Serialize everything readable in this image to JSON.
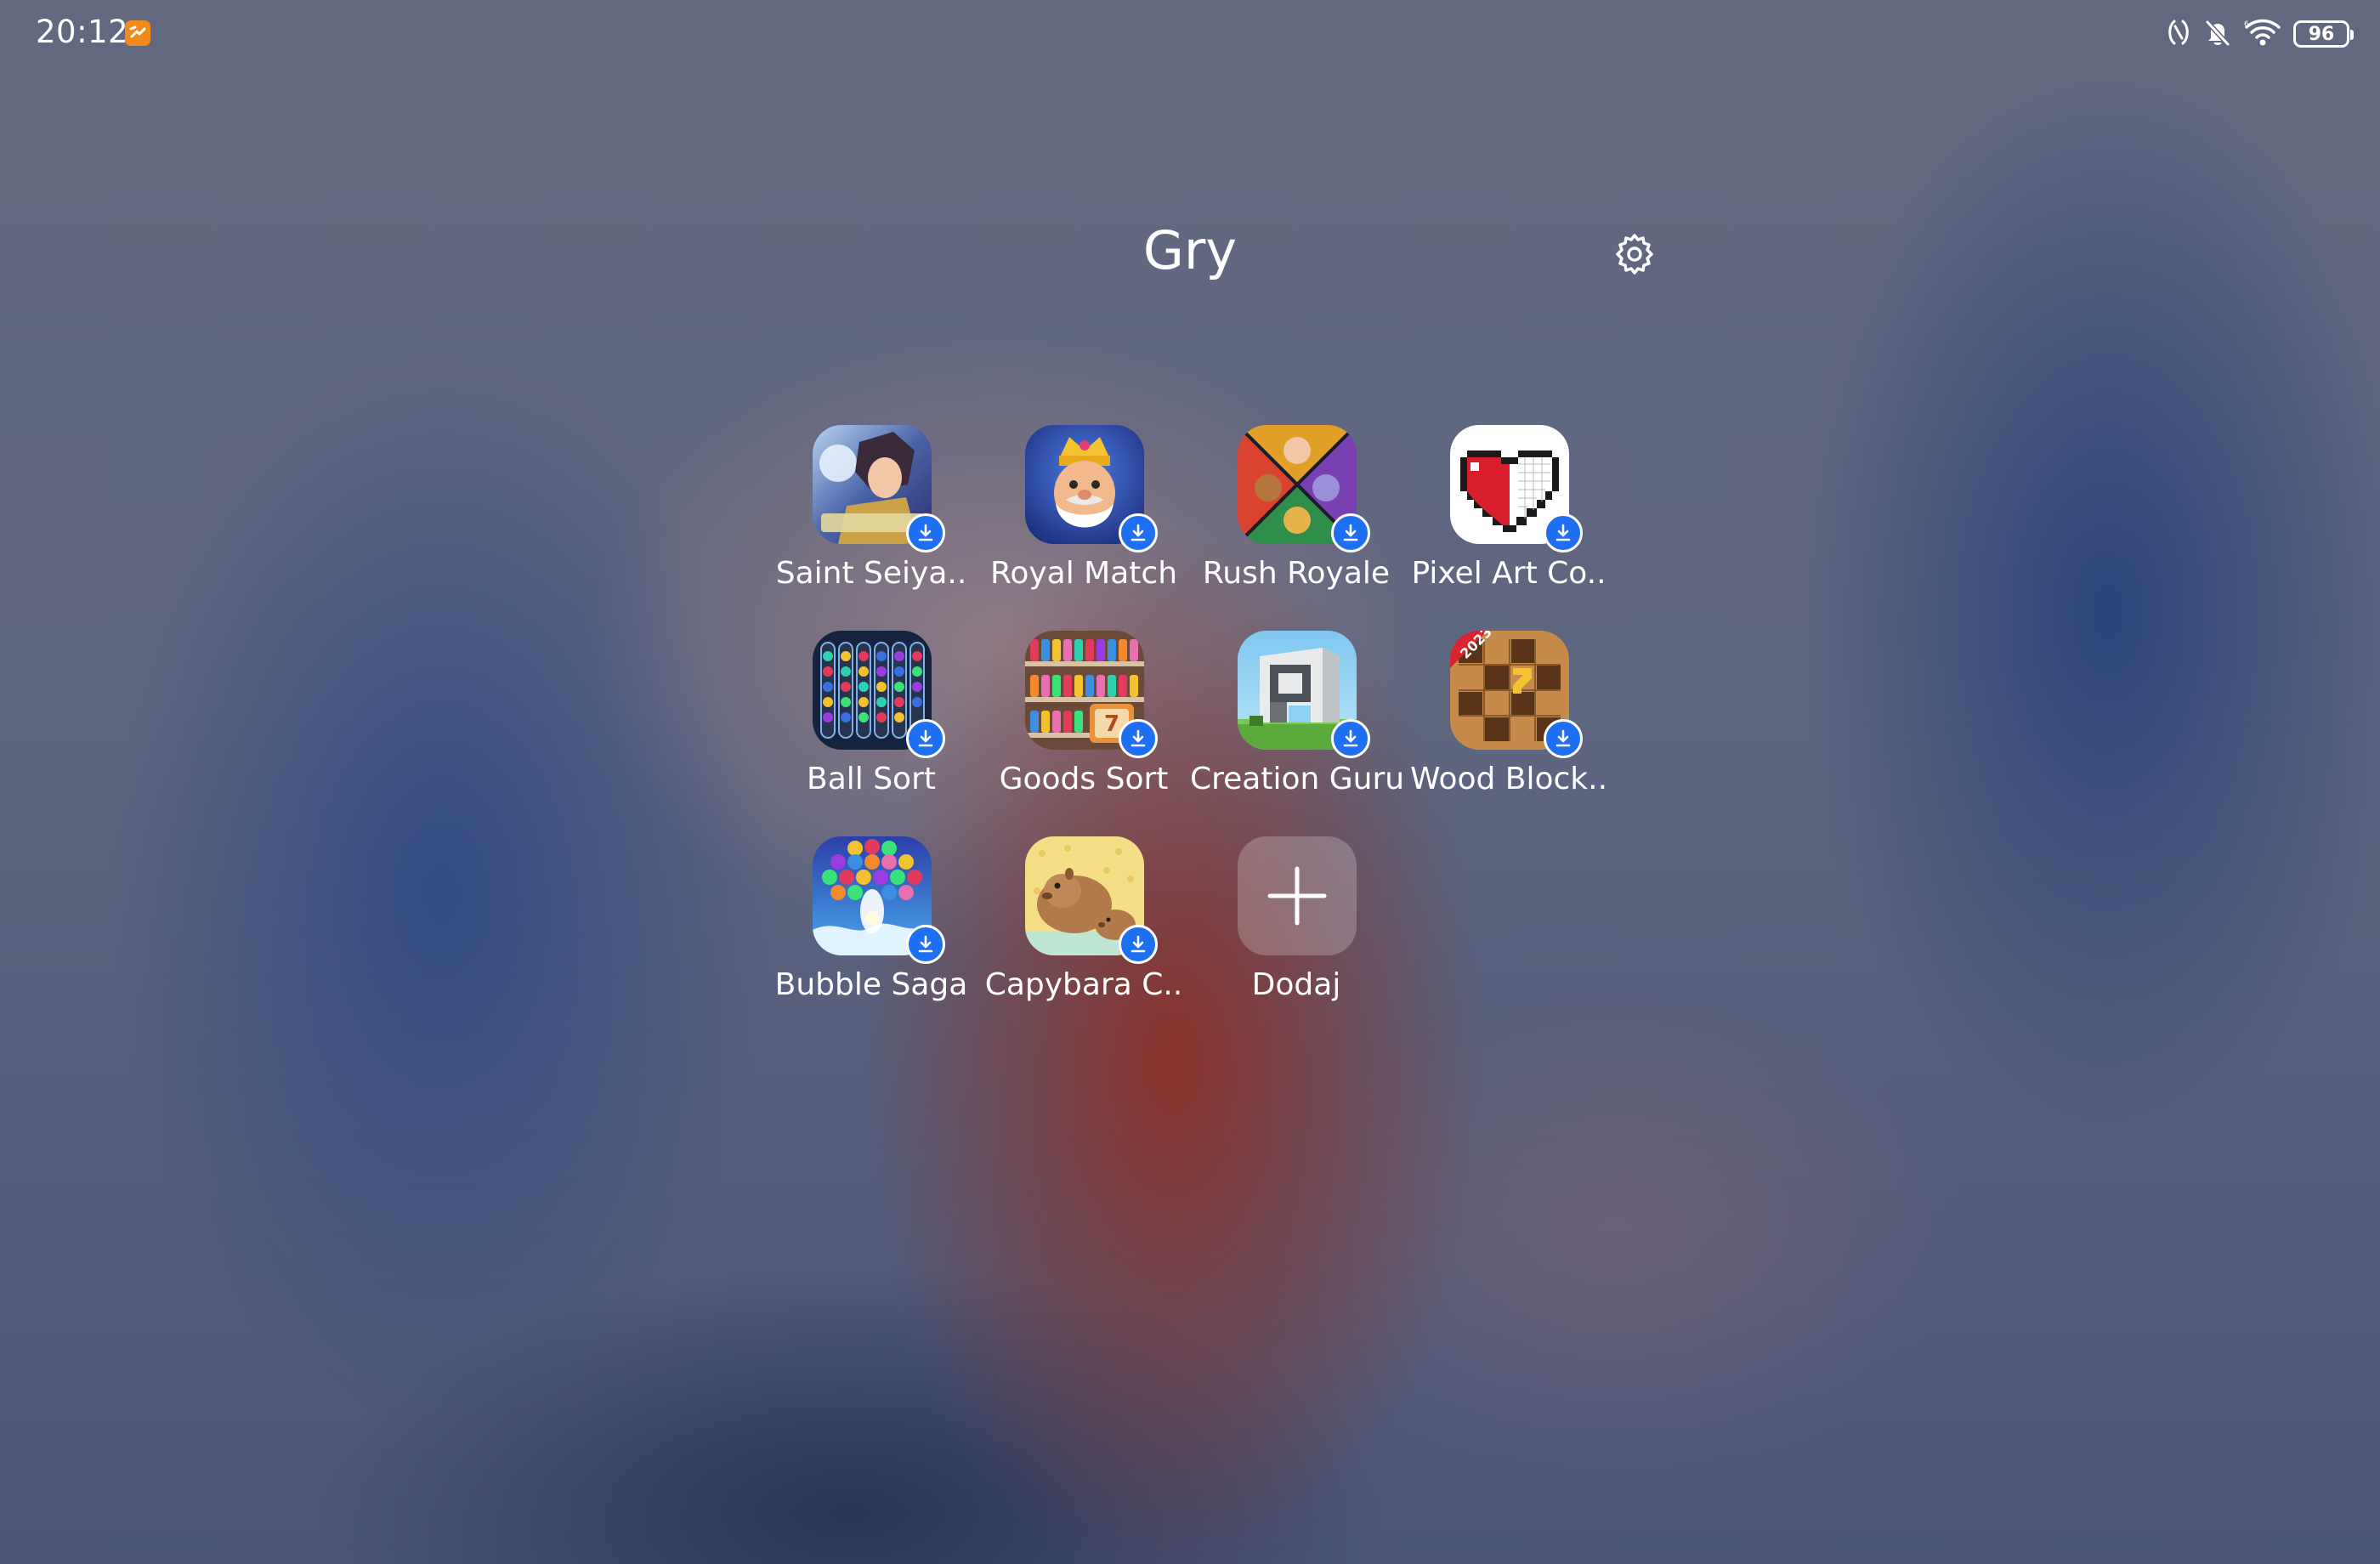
{
  "status_bar": {
    "time": "20:12",
    "battery_level": "96",
    "icons": [
      "nfc-icon",
      "mute-icon",
      "wifi-icon",
      "battery-icon"
    ]
  },
  "folder": {
    "title": "Gry",
    "settings_icon": "gear-icon"
  },
  "apps": [
    {
      "label": "Saint Seiya..",
      "icon": "saint-seiya-app-icon",
      "downloading": true
    },
    {
      "label": "Royal Match",
      "icon": "royal-match-app-icon",
      "downloading": true
    },
    {
      "label": "Rush Royale",
      "icon": "rush-royale-app-icon",
      "downloading": true
    },
    {
      "label": "Pixel Art Co..",
      "icon": "pixel-art-app-icon",
      "downloading": true
    },
    {
      "label": "Ball Sort",
      "icon": "ball-sort-app-icon",
      "downloading": true
    },
    {
      "label": "Goods Sort",
      "icon": "goods-sort-app-icon",
      "downloading": true
    },
    {
      "label": "Creation Guru",
      "icon": "creation-guru-app-icon",
      "downloading": true
    },
    {
      "label": "Wood Block..",
      "icon": "wood-block-app-icon",
      "downloading": true
    },
    {
      "label": "Bubble Saga",
      "icon": "bubble-saga-app-icon",
      "downloading": true
    },
    {
      "label": "Capybara C..",
      "icon": "capybara-app-icon",
      "downloading": true
    }
  ],
  "add_button": {
    "label": "Dodaj",
    "icon": "plus-icon"
  },
  "colors": {
    "download_badge": "#1f6ff2",
    "notification_badge": "#f08a1d",
    "text": "#ffffff"
  }
}
